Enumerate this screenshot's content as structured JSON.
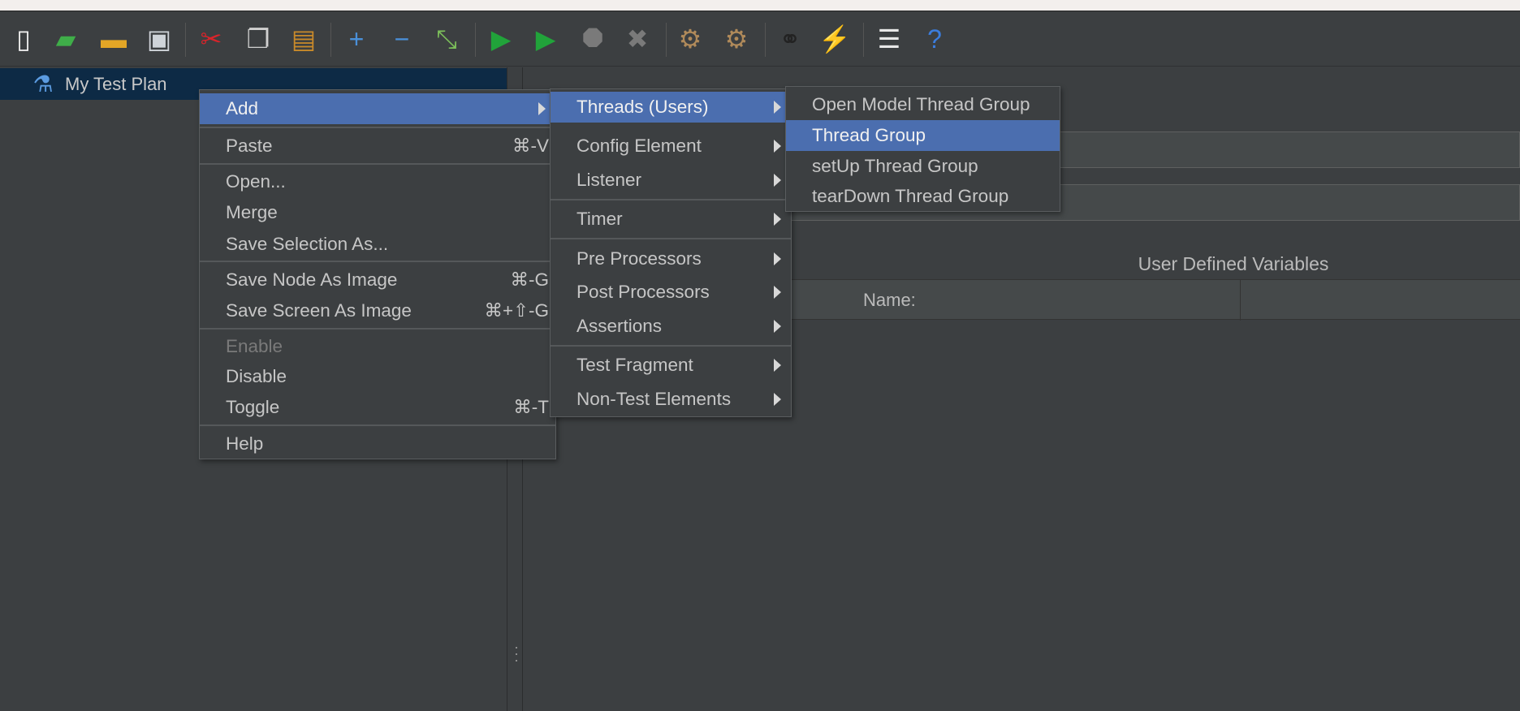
{
  "toolbar": {
    "icons": [
      {
        "name": "new-icon",
        "glyph": "▯",
        "color": "#f2f2f2"
      },
      {
        "name": "templates-icon",
        "glyph": "▰",
        "color": "#3fae49"
      },
      {
        "name": "open-icon",
        "glyph": "▬",
        "color": "#e3a626"
      },
      {
        "name": "save-icon",
        "glyph": "▣",
        "color": "#cfd4d9"
      },
      {
        "name": "cut-icon",
        "glyph": "✂",
        "color": "#d8242a"
      },
      {
        "name": "copy-icon",
        "glyph": "❐",
        "color": "#d0d0d0"
      },
      {
        "name": "paste-icon",
        "glyph": "▤",
        "color": "#c98a2a"
      },
      {
        "name": "expand-icon",
        "glyph": "+",
        "color": "#4a90d9"
      },
      {
        "name": "collapse-icon",
        "glyph": "−",
        "color": "#4a90d9"
      },
      {
        "name": "toggle-icon",
        "glyph": "⤡",
        "color": "#7cbf5a"
      },
      {
        "name": "start-icon",
        "glyph": "▶",
        "color": "#21a33a"
      },
      {
        "name": "start-no-pauses-icon",
        "glyph": "▶",
        "color": "#21a33a"
      },
      {
        "name": "stop-icon",
        "glyph": "⯃",
        "color": "#7a7a7a"
      },
      {
        "name": "shutdown-icon",
        "glyph": "✖",
        "color": "#7a7a7a"
      },
      {
        "name": "clear-icon",
        "glyph": "⚙",
        "color": "#b08a5a"
      },
      {
        "name": "clear-all-icon",
        "glyph": "⚙",
        "color": "#b08a5a"
      },
      {
        "name": "search-icon",
        "glyph": "⚭",
        "color": "#222222"
      },
      {
        "name": "reset-search-icon",
        "glyph": "⚡",
        "color": "#f0c020"
      },
      {
        "name": "function-helper-icon",
        "glyph": "☰",
        "color": "#e8e8e8"
      },
      {
        "name": "help-icon",
        "glyph": "?",
        "color": "#3b7ddd"
      }
    ]
  },
  "tree": {
    "root_label": "My Test Plan"
  },
  "content": {
    "udv_title": "User Defined Variables",
    "name_column": "Name:"
  },
  "context_menu": {
    "items": [
      {
        "label": "Add",
        "submenu": true
      },
      {
        "label": "Paste",
        "shortcut": "⌘-V"
      },
      {
        "label": "Open..."
      },
      {
        "label": "Merge"
      },
      {
        "label": "Save Selection As..."
      },
      {
        "label": "Save Node As Image",
        "shortcut": "⌘-G"
      },
      {
        "label": "Save Screen As Image",
        "shortcut": "⌘+⇧-G"
      },
      {
        "label": "Enable",
        "disabled": true
      },
      {
        "label": "Disable"
      },
      {
        "label": "Toggle",
        "shortcut": "⌘-T"
      },
      {
        "label": "Help"
      }
    ]
  },
  "add_menu": {
    "items": [
      {
        "label": "Threads (Users)"
      },
      {
        "label": "Config Element"
      },
      {
        "label": "Listener"
      },
      {
        "label": "Timer"
      },
      {
        "label": "Pre Processors"
      },
      {
        "label": "Post Processors"
      },
      {
        "label": "Assertions"
      },
      {
        "label": "Test Fragment"
      },
      {
        "label": "Non-Test Elements"
      }
    ]
  },
  "threads_menu": {
    "items": [
      {
        "label": "Open Model Thread Group"
      },
      {
        "label": "Thread Group",
        "selected": true
      },
      {
        "label": "setUp Thread Group"
      },
      {
        "label": "tearDown Thread Group"
      }
    ]
  },
  "colors": {
    "background": "#3c3f41",
    "selection": "#4b6eaf",
    "tree_selection": "#0d2a45"
  }
}
